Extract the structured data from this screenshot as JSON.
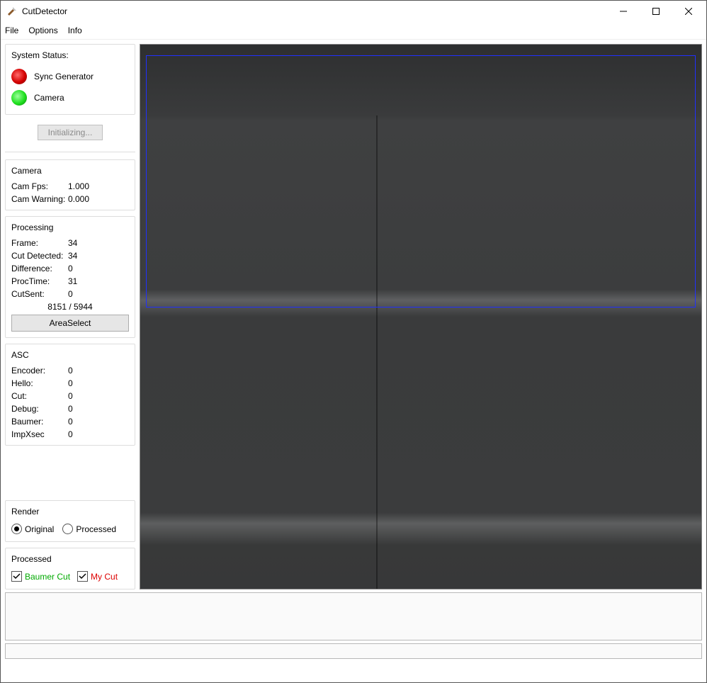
{
  "window": {
    "title": "CutDetector"
  },
  "menu": {
    "file": "File",
    "options": "Options",
    "info": "Info"
  },
  "system": {
    "title": "System Status:",
    "sync_label": "Sync Generator",
    "camera_label": "Camera",
    "init_button": "Initializing..."
  },
  "camera": {
    "title": "Camera",
    "fps_label": "Cam Fps:",
    "fps_value": "1.000",
    "warn_label": "Cam Warning:",
    "warn_value": "0.000"
  },
  "processing": {
    "title": "Processing",
    "frame_label": "Frame:",
    "frame_value": "34",
    "cutdet_label": "Cut Detected:",
    "cutdet_value": "34",
    "diff_label": "Difference:",
    "diff_value": "0",
    "proctime_label": "ProcTime:",
    "proctime_value": "31",
    "cutsent_label": "CutSent:",
    "cutsent_value": "0",
    "counts": "8151  /   5944",
    "area_button": "AreaSelect"
  },
  "asc": {
    "title": "ASC",
    "encoder_label": "Encoder:",
    "encoder_value": "0",
    "hello_label": "Hello:",
    "hello_value": "0",
    "cut_label": "Cut:",
    "cut_value": "0",
    "debug_label": "Debug:",
    "debug_value": "0",
    "baumer_label": "Baumer:",
    "baumer_value": "0",
    "impx_label": "ImpXsec",
    "impx_value": "0"
  },
  "render": {
    "title": "Render",
    "original": "Original",
    "processed": "Processed"
  },
  "processed": {
    "title": "Processed",
    "baumer": "Baumer Cut",
    "mycut": "My Cut"
  }
}
